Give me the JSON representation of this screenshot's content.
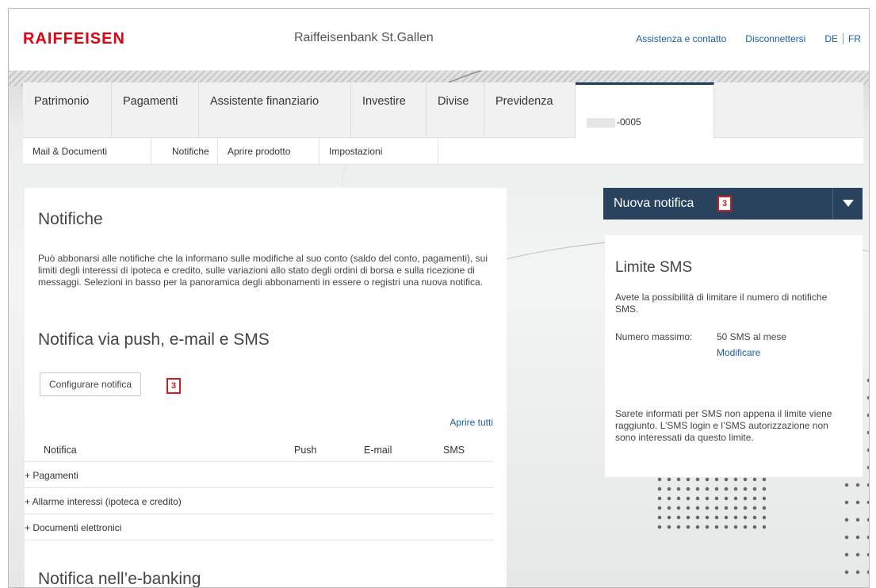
{
  "header": {
    "logo": "RAIFFEISEN",
    "bank_name": "Raiffeisenbank St.Gallen",
    "links": {
      "assistance": "Assistenza e contatto",
      "logout": "Disconnettersi"
    },
    "languages": [
      "DE",
      "FR"
    ]
  },
  "nav": {
    "tabs": [
      "Patrimonio",
      "Pagamenti",
      "Assistente finanziario",
      "Investire",
      "Divise",
      "Previdenza"
    ],
    "account_suffix": "-0005"
  },
  "subnav": {
    "items": [
      "Mail & Documenti",
      "Notifiche",
      "Aprire prodotto",
      "Impostazioni"
    ]
  },
  "main": {
    "title": "Notifiche",
    "intro": "Può abbonarsi alle notifiche che la informano sulle modifiche al suo conto (saldo del conto, pagamenti), sui limiti degli interessi di ipoteca e credito, sulle variazioni allo stato degli ordini di borsa e sulla ricezione di messaggi. Selezioni in basso per la panoramica degli abbonamenti in essere o registri una nuova notifica.",
    "push_section_title": "Notifica via push, e-mail e SMS",
    "configure_button": "Configurare notifica",
    "configure_badge": "3",
    "open_all": "Aprire tutti",
    "table_headers": {
      "notifica": "Notifica",
      "push": "Push",
      "email": "E-mail",
      "sms": "SMS"
    },
    "rows": [
      "+ Pagamenti",
      "+ Allarme interessi (ipoteca e credito)",
      "+ Documenti elettronici"
    ],
    "ebanking_section_title": "Notifica nell’e-banking"
  },
  "sidebar": {
    "new_notification": "Nuova notifica",
    "new_notification_badge": "3",
    "sms_limit": {
      "title": "Limite SMS",
      "description": "Avete la possibilità di limitare il numero di notifiche SMS.",
      "max_label": "Numero massimo:",
      "max_value": "50 SMS al mese",
      "modify": "Modificare",
      "info": "Sarete informati per SMS non appena il limite viene raggiunto. L’SMS login e l’SMS autorizzazione non sono interessati da questo limite."
    }
  },
  "colors": {
    "brand_red": "#e3000f",
    "link_blue": "#1a5ea8",
    "dark_navy": "#29435e",
    "badge_red": "#d71920"
  }
}
